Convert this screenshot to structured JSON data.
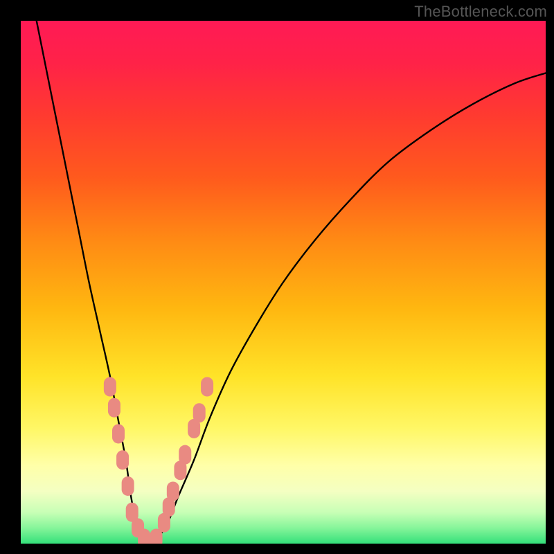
{
  "attribution": "TheBottleneck.com",
  "gradient": {
    "stops": [
      {
        "offset": 0.0,
        "color": "#ff1a55"
      },
      {
        "offset": 0.08,
        "color": "#ff2248"
      },
      {
        "offset": 0.18,
        "color": "#ff3a30"
      },
      {
        "offset": 0.3,
        "color": "#ff5a1d"
      },
      {
        "offset": 0.42,
        "color": "#ff8a14"
      },
      {
        "offset": 0.55,
        "color": "#ffb710"
      },
      {
        "offset": 0.68,
        "color": "#ffe328"
      },
      {
        "offset": 0.78,
        "color": "#fff766"
      },
      {
        "offset": 0.85,
        "color": "#ffffa8"
      },
      {
        "offset": 0.9,
        "color": "#f4ffc2"
      },
      {
        "offset": 0.94,
        "color": "#c8ffb6"
      },
      {
        "offset": 0.97,
        "color": "#86f59a"
      },
      {
        "offset": 1.0,
        "color": "#34e07a"
      }
    ]
  },
  "chart_data": {
    "type": "line",
    "title": "",
    "xlabel": "",
    "ylabel": "",
    "xlim": [
      0,
      100
    ],
    "ylim": [
      0,
      100
    ],
    "grid": false,
    "legend": false,
    "notes": "V-shaped bottleneck curve. x-axis is component ratio percentage, y-axis is bottleneck percentage (0% at bottom = green = optimal, 100% at top = red = severe bottleneck). Values estimated from pixel positions.",
    "series": [
      {
        "name": "bottleneck-curve",
        "color": "#000000",
        "x": [
          3,
          5,
          7,
          9,
          11,
          13,
          15,
          17,
          18.5,
          20,
          21,
          22,
          23,
          24.5,
          26,
          28,
          30,
          33,
          36,
          40,
          45,
          50,
          56,
          63,
          70,
          78,
          86,
          94,
          100
        ],
        "y": [
          100,
          90,
          80,
          70,
          60,
          50,
          41,
          32,
          24,
          16,
          9,
          4,
          1,
          0,
          1,
          4,
          9,
          16,
          24,
          33,
          42,
          50,
          58,
          66,
          73,
          79,
          84,
          88,
          90
        ]
      }
    ],
    "markers": [
      {
        "name": "sample-points",
        "color": "#e98a82",
        "shape": "rounded-rect",
        "points": [
          {
            "x": 17.0,
            "y": 30
          },
          {
            "x": 17.8,
            "y": 26
          },
          {
            "x": 18.6,
            "y": 21
          },
          {
            "x": 19.4,
            "y": 16
          },
          {
            "x": 20.4,
            "y": 11
          },
          {
            "x": 21.2,
            "y": 6
          },
          {
            "x": 22.3,
            "y": 3
          },
          {
            "x": 23.5,
            "y": 1
          },
          {
            "x": 24.6,
            "y": 0
          },
          {
            "x": 25.8,
            "y": 1
          },
          {
            "x": 27.3,
            "y": 4
          },
          {
            "x": 28.2,
            "y": 7
          },
          {
            "x": 29.0,
            "y": 10
          },
          {
            "x": 30.4,
            "y": 14
          },
          {
            "x": 31.3,
            "y": 17
          },
          {
            "x": 33.0,
            "y": 22
          },
          {
            "x": 34.0,
            "y": 25
          },
          {
            "x": 35.5,
            "y": 30
          }
        ]
      }
    ]
  }
}
